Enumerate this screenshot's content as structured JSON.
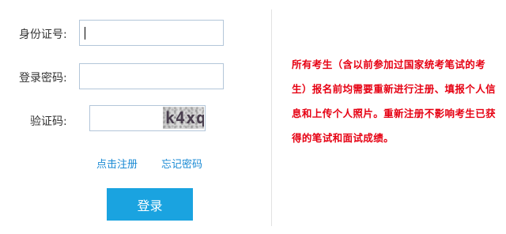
{
  "form": {
    "id_label": "身份证号:",
    "id_value": "",
    "password_label": "登录密码:",
    "password_value": "",
    "captcha_label": "验证码:",
    "captcha_value": "",
    "captcha_image_text": "k4xq"
  },
  "links": {
    "register": "点击注册",
    "forgot_password": "忘记密码"
  },
  "login_button": "登录",
  "notice": "所有考生（含以前参加过国家统考笔试的考生）报名前均需要重新进行注册、填报个人信息和上传个人照片。重新注册不影响考生已获得的笔试和面试成绩。",
  "colors": {
    "primary": "#1aa3e0",
    "link": "#1a8ad4",
    "notice": "#e60012"
  }
}
